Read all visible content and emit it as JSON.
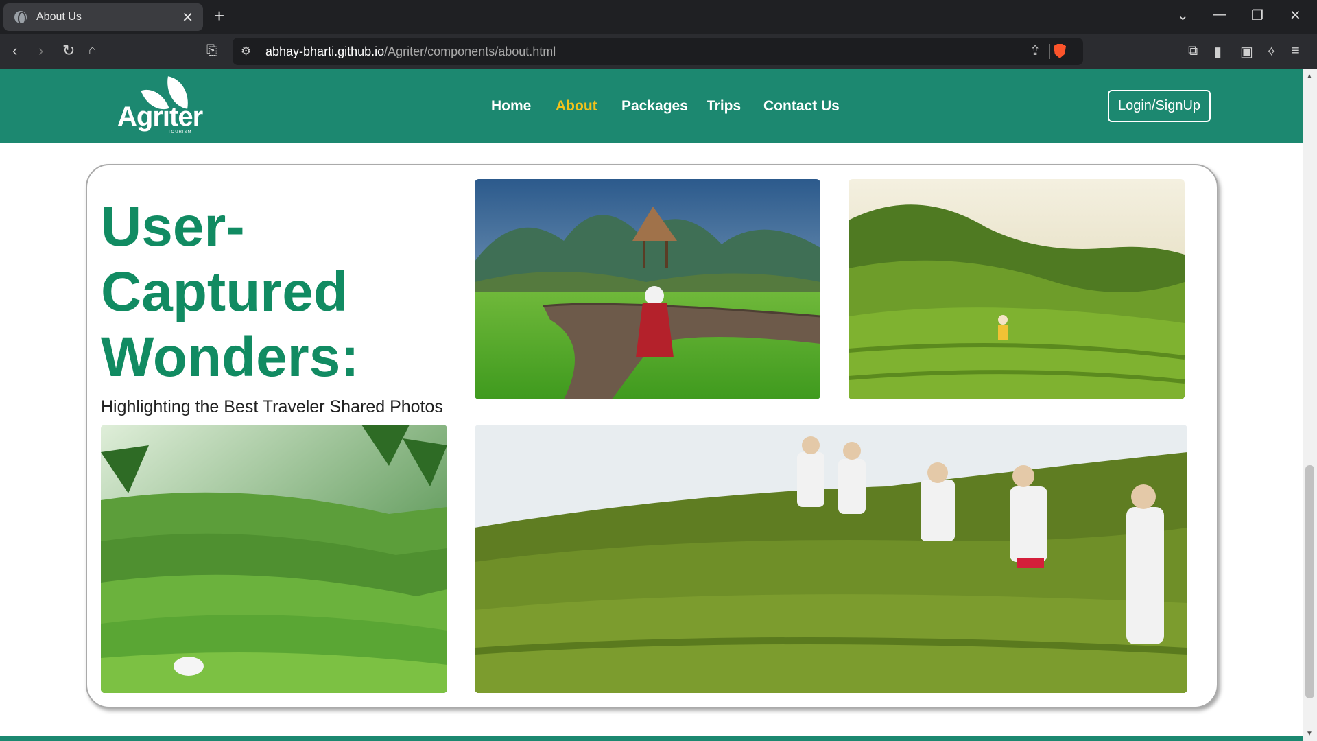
{
  "browser": {
    "tab_title": "About Us",
    "tab_close": "✕",
    "new_tab": "+",
    "url_host": "abhay-bharti.github.io",
    "url_path": "/Agriter/components/about.html"
  },
  "site": {
    "logo_text": "Agriter",
    "logo_sub": "TOURISM",
    "nav": [
      "Home",
      "About",
      "Packages",
      "Trips",
      "Contact Us"
    ],
    "active_nav": "About",
    "login_label": "Login/SignUp"
  },
  "gallery": {
    "heading": "User-Captured Wonders:",
    "subheading": "Highlighting the Best Traveler Shared Photos",
    "photos": [
      {
        "name": "boardwalk-rice-field"
      },
      {
        "name": "tea-hills"
      },
      {
        "name": "rice-terraces"
      },
      {
        "name": "tea-pickers"
      }
    ]
  },
  "colors": {
    "brand": "#1c8870",
    "heading": "#118b62",
    "active": "#f2c21b"
  }
}
